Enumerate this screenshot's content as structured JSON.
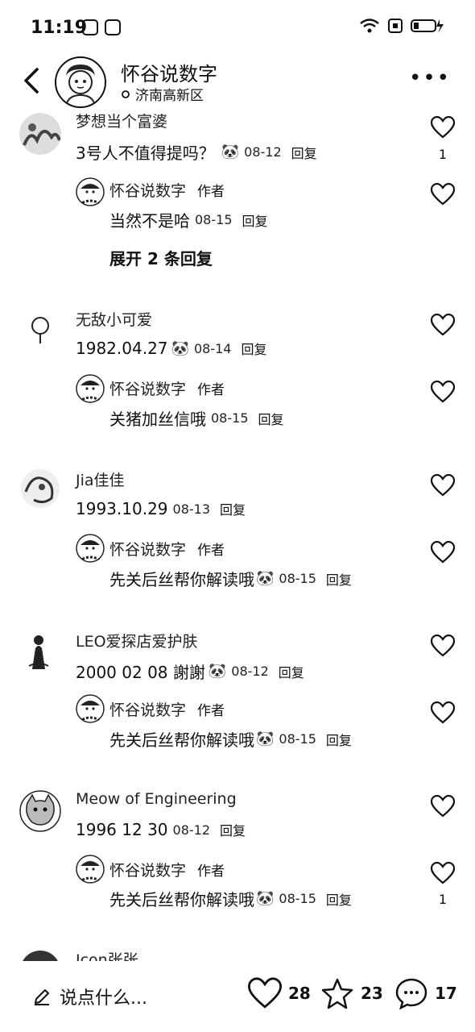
{
  "status_bar": {
    "time": "11:19"
  },
  "header": {
    "title": "怀谷说数字",
    "location": "济南高新区"
  },
  "comments": [
    {
      "username": "梦想当个富婆",
      "text": "3号人不值得提吗？",
      "date": "08-12",
      "reply_label": "回复",
      "likes": "1",
      "author_reply": {
        "name": "怀谷说数字",
        "tag": "作者",
        "text": "当然不是哈",
        "date": "08-15",
        "reply_label": "回复"
      },
      "expand_label": "展开 2 条回复"
    },
    {
      "username": "无敌小可爱",
      "text": "1982.04.27",
      "date": "08-14",
      "reply_label": "回复",
      "author_reply": {
        "name": "怀谷说数字",
        "tag": "作者",
        "text": "关猪加丝信哦",
        "date": "08-15",
        "reply_label": "回复"
      }
    },
    {
      "username": "Jia佳佳",
      "text": "1993.10.29",
      "date": "08-13",
      "reply_label": "回复",
      "author_reply": {
        "name": "怀谷说数字",
        "tag": "作者",
        "text": "先关后丝帮你解读哦",
        "date": "08-15",
        "reply_label": "回复"
      }
    },
    {
      "username": "LEO爱探店爱护肤",
      "text": "2000 02 08 謝謝",
      "date": "08-12",
      "reply_label": "回复",
      "author_reply": {
        "name": "怀谷说数字",
        "tag": "作者",
        "text": "先关后丝帮你解读哦",
        "date": "08-15",
        "reply_label": "回复"
      }
    },
    {
      "username": "Meow of Engineering",
      "text": "1996 12 30",
      "date": "08-12",
      "reply_label": "回复",
      "author_reply": {
        "name": "怀谷说数字",
        "tag": "作者",
        "text": "先关后丝帮你解读哦",
        "date": "08-15",
        "reply_label": "回复",
        "likes": "1"
      }
    },
    {
      "username": "Icon张张"
    }
  ],
  "bottom_bar": {
    "placeholder": "说点什么...",
    "likes": "28",
    "favorites": "23",
    "comments": "17"
  },
  "icons": [
    "back-arrow-icon",
    "more-icon",
    "location-icon",
    "heart-icon",
    "star-icon",
    "comment-icon",
    "pencil-icon",
    "emoji-icon"
  ]
}
